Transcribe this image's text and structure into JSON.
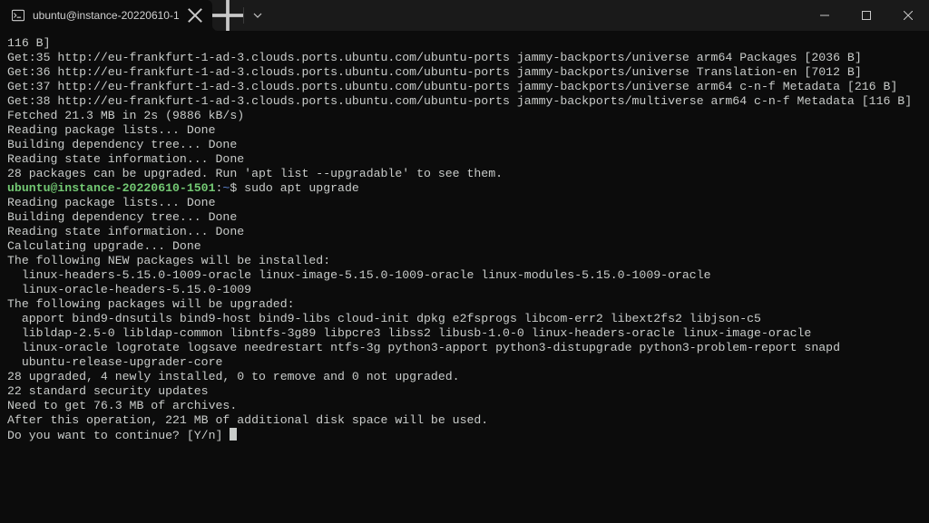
{
  "tab": {
    "title": "ubuntu@instance-20220610-1"
  },
  "prompt": {
    "user_host": "ubuntu@instance-20220610-1501",
    "path": "~",
    "command": "sudo apt upgrade"
  },
  "lines_before": [
    "116 B]",
    "Get:35 http://eu-frankfurt-1-ad-3.clouds.ports.ubuntu.com/ubuntu-ports jammy-backports/universe arm64 Packages [2036 B]",
    "Get:36 http://eu-frankfurt-1-ad-3.clouds.ports.ubuntu.com/ubuntu-ports jammy-backports/universe Translation-en [7012 B]",
    "Get:37 http://eu-frankfurt-1-ad-3.clouds.ports.ubuntu.com/ubuntu-ports jammy-backports/universe arm64 c-n-f Metadata [216 B]",
    "Get:38 http://eu-frankfurt-1-ad-3.clouds.ports.ubuntu.com/ubuntu-ports jammy-backports/multiverse arm64 c-n-f Metadata [116 B]",
    "Fetched 21.3 MB in 2s (9886 kB/s)",
    "Reading package lists... Done",
    "Building dependency tree... Done",
    "Reading state information... Done",
    "28 packages can be upgraded. Run 'apt list --upgradable' to see them."
  ],
  "lines_after": [
    "Reading package lists... Done",
    "Building dependency tree... Done",
    "Reading state information... Done",
    "Calculating upgrade... Done",
    "The following NEW packages will be installed:",
    "  linux-headers-5.15.0-1009-oracle linux-image-5.15.0-1009-oracle linux-modules-5.15.0-1009-oracle",
    "  linux-oracle-headers-5.15.0-1009",
    "The following packages will be upgraded:",
    "  apport bind9-dnsutils bind9-host bind9-libs cloud-init dpkg e2fsprogs libcom-err2 libext2fs2 libjson-c5",
    "  libldap-2.5-0 libldap-common libntfs-3g89 libpcre3 libss2 libusb-1.0-0 linux-headers-oracle linux-image-oracle",
    "  linux-oracle logrotate logsave needrestart ntfs-3g python3-apport python3-distupgrade python3-problem-report snapd",
    "  ubuntu-release-upgrader-core",
    "28 upgraded, 4 newly installed, 0 to remove and 0 not upgraded.",
    "22 standard security updates",
    "Need to get 76.3 MB of archives.",
    "After this operation, 221 MB of additional disk space will be used.",
    "Do you want to continue? [Y/n] "
  ]
}
